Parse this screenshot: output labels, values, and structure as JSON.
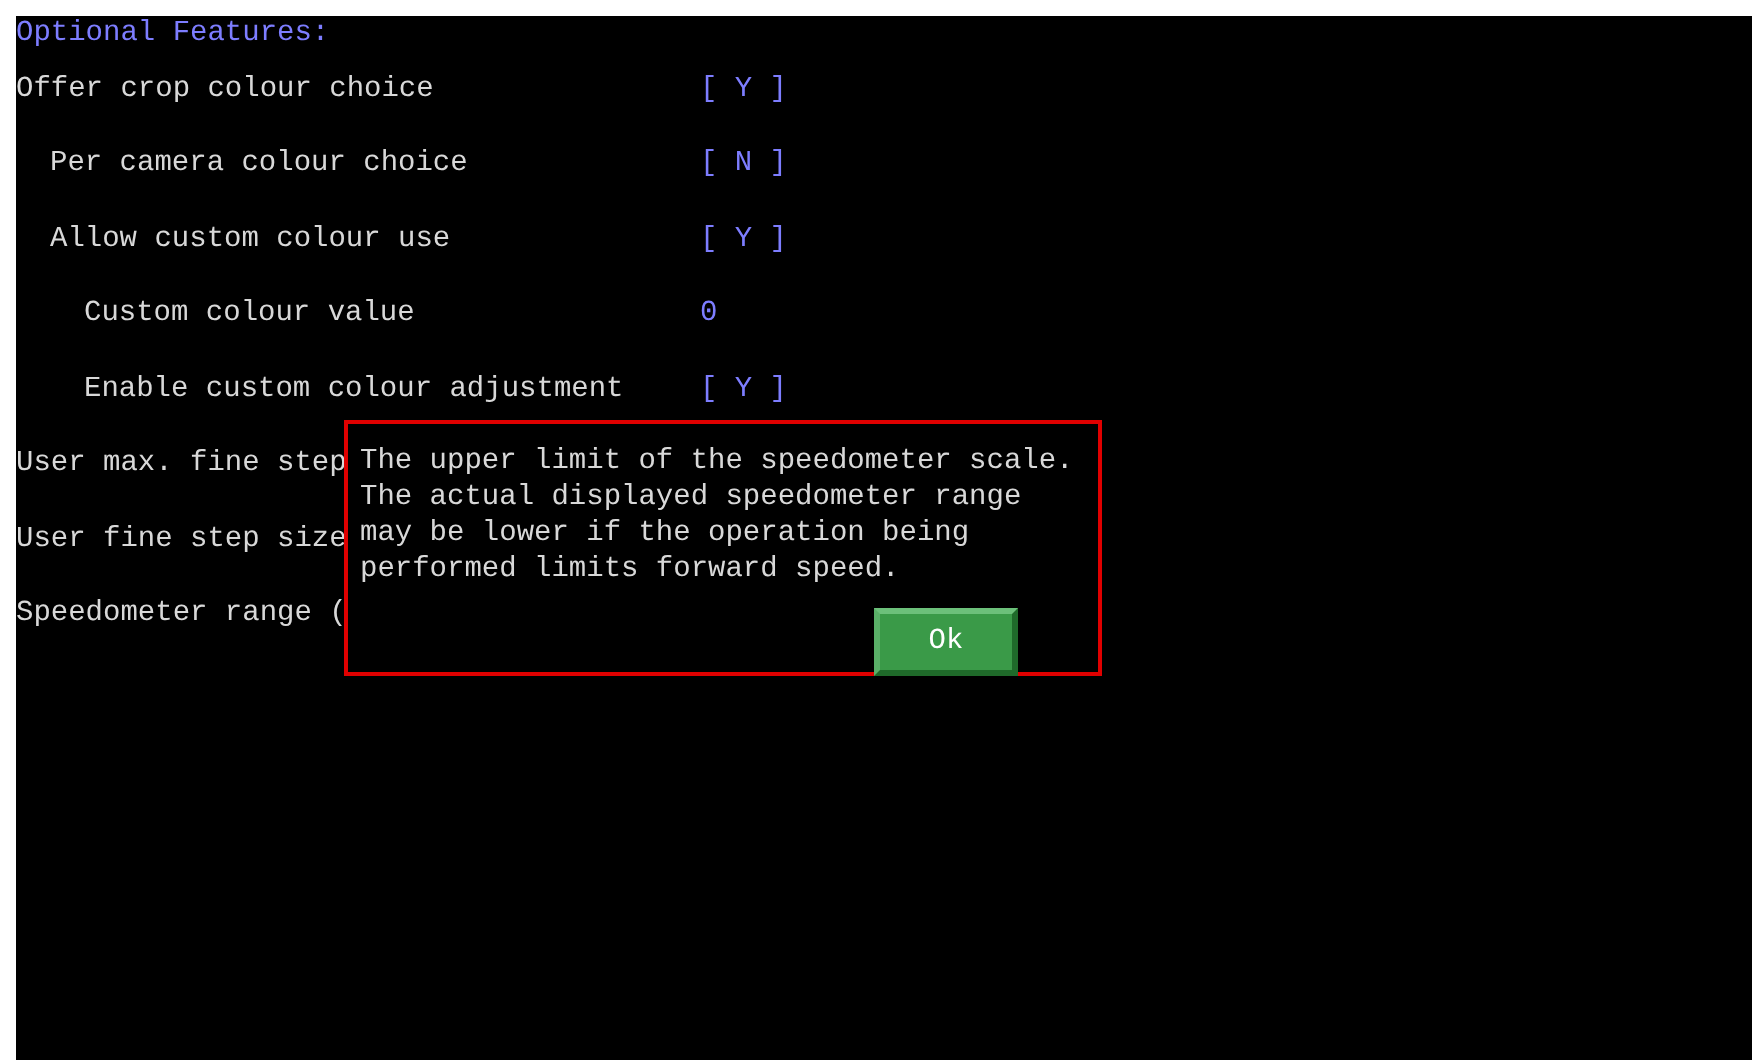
{
  "heading": "Optional Features:",
  "settings": [
    {
      "label": "Offer crop colour choice",
      "value": "[ Y ]",
      "children": [
        {
          "label": "Per camera colour choice",
          "value": "[ N ]"
        },
        {
          "label": "Allow custom colour use",
          "value": "[ Y ]",
          "children": [
            {
              "label": "Custom colour value",
              "value": "0"
            },
            {
              "label": "Enable custom colour adjustment",
              "value": "[ Y ]"
            }
          ]
        }
      ]
    },
    {
      "label": "User max. fine step"
    },
    {
      "label": "User fine step size"
    },
    {
      "label": "Speedometer range ("
    }
  ],
  "dialog": {
    "message": "The upper limit of the speedometer scale.  The actual displayed speedometer range may be lower if the operation being performed limits forward speed.",
    "button": "Ok"
  }
}
